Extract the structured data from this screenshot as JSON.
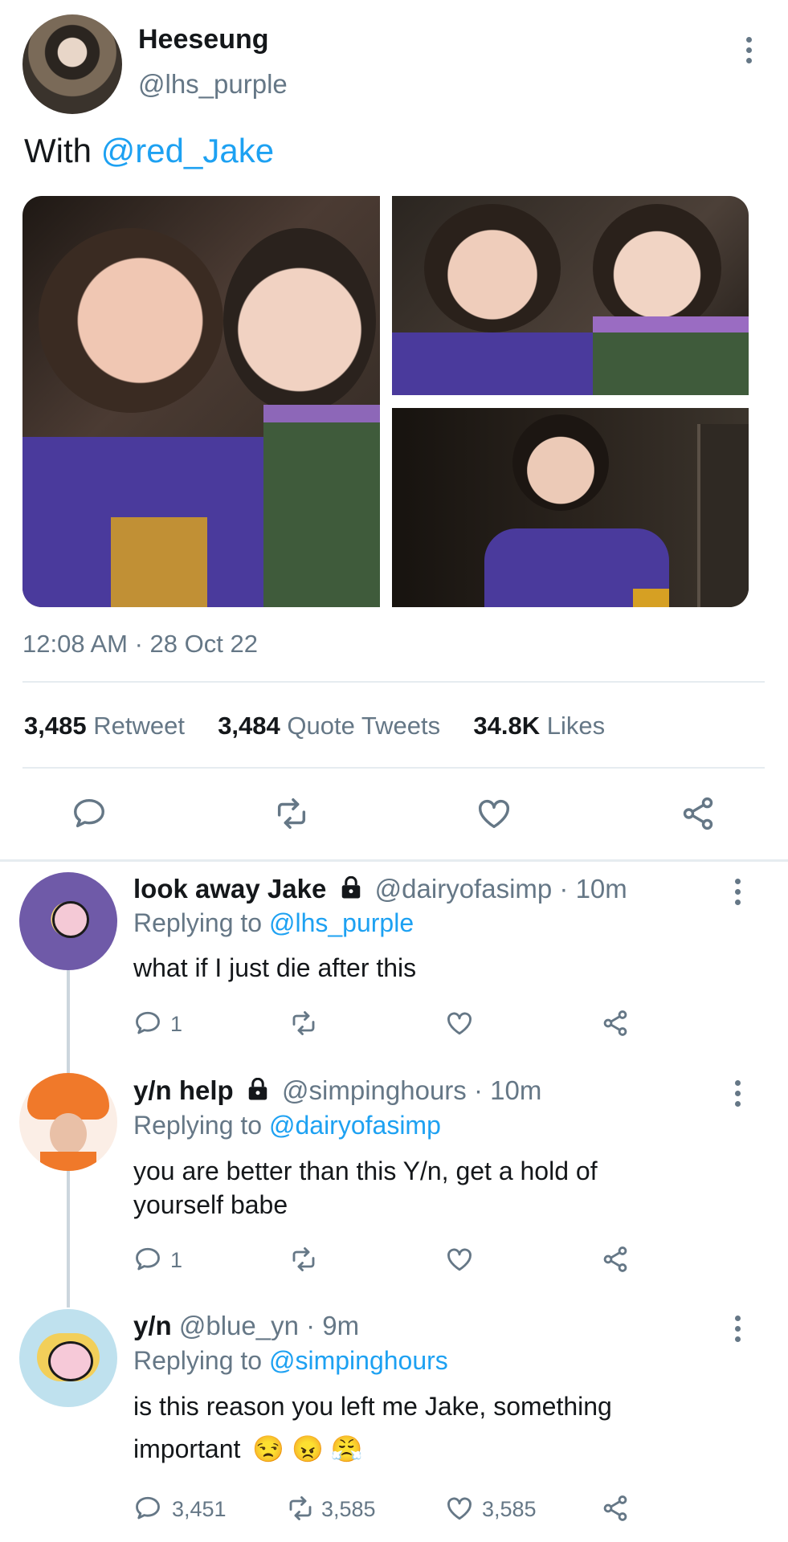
{
  "post": {
    "display_name": "Heeseung",
    "handle": "@lhs_purple",
    "text_prefix": "With",
    "mention": "@red_Jake",
    "timestamp": "12:08 AM · 28 Oct 22",
    "stats": [
      {
        "value": "3,485",
        "label": "Retweet"
      },
      {
        "value": "3,484",
        "label": "Quote Tweets"
      },
      {
        "value": "34.8K",
        "label": "Likes"
      }
    ]
  },
  "replies": [
    {
      "display_name": "look away Jake",
      "handle_time": "@dairyofasimp · 10m",
      "replying_prefix": "Replying to",
      "replying_to": "@lhs_purple",
      "text_lines": [
        "what if I just die after this"
      ],
      "counts": {
        "reply": "1",
        "retweet": "",
        "like": ""
      }
    },
    {
      "display_name": "y/n help",
      "handle_time": "@simpinghours · 10m",
      "replying_prefix": "Replying to",
      "replying_to": "@dairyofasimp",
      "text_lines": [
        "you are better than this Y/n, get a hold of",
        "yourself babe"
      ],
      "counts": {
        "reply": "1",
        "retweet": "",
        "like": ""
      }
    },
    {
      "display_name": "y/n",
      "handle_time": "@blue_yn · 9m",
      "replying_prefix": "Replying to",
      "replying_to": "@simpinghours",
      "text_lines": [
        "is this reason you left me Jake, something",
        "important"
      ],
      "emoji": [
        "😒",
        "😠",
        "😤"
      ],
      "counts": {
        "reply": "3,451",
        "retweet": "3,585",
        "like": "3,585"
      }
    }
  ],
  "colors": {
    "accent": "#1da1f2",
    "muted": "#657786",
    "divider": "#e6ecf0"
  }
}
